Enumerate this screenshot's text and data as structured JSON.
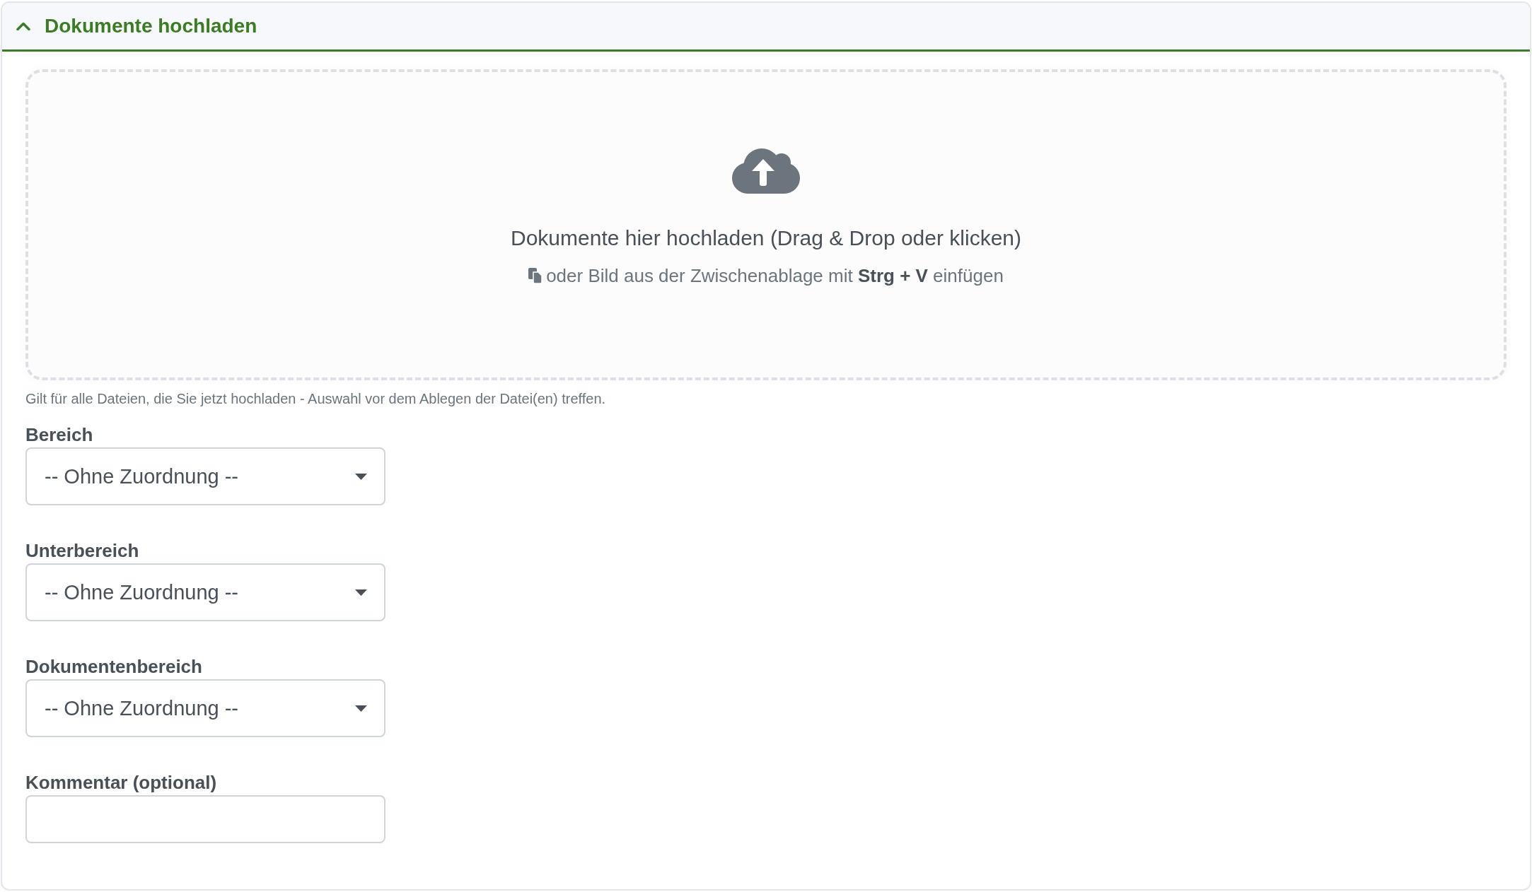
{
  "panel": {
    "title": "Dokumente hochladen",
    "expanded": true
  },
  "dropzone": {
    "title": "Dokumente hier hochladen (Drag & Drop oder klicken)",
    "hint": "oder Bild aus der Zwischenablage mit **Strg + V** einfügen"
  },
  "helper_text": "Gilt für alle Dateien, die Sie jetzt hochladen - Auswahl vor dem Ablegen der Datei(en) treffen.",
  "fields": [
    {
      "kind": "select",
      "label": "Bereich",
      "value": "-- Ohne Zuordnung --"
    },
    {
      "kind": "select",
      "label": "Unterbereich",
      "value": "-- Ohne Zuordnung --"
    },
    {
      "kind": "select",
      "label": "Dokumentenbereich",
      "value": "-- Ohne Zuordnung --"
    },
    {
      "kind": "text",
      "label": "Kommentar (optional)"
    }
  ]
}
